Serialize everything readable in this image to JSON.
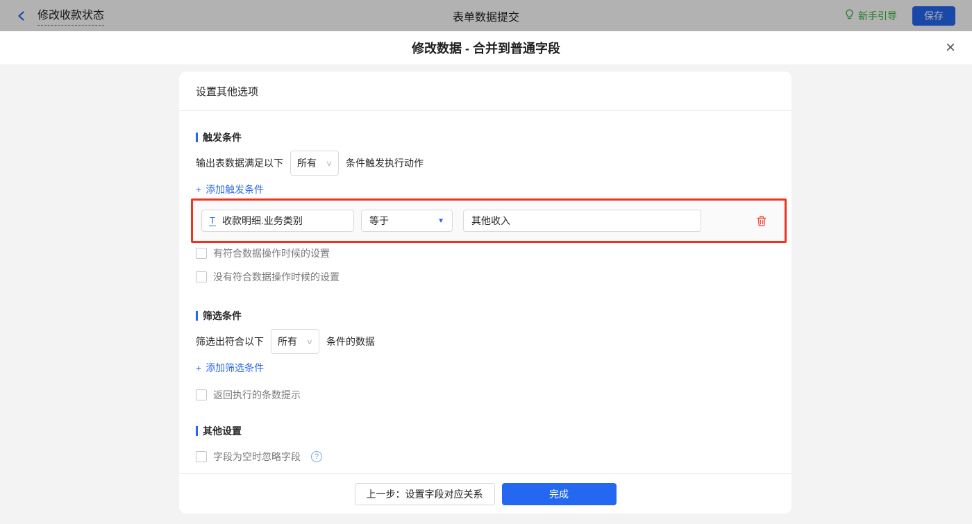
{
  "topbar": {
    "back_label": "修改收款状态",
    "center_title": "表单数据提交",
    "guide_label": "新手引导",
    "save_label": "保存"
  },
  "dialog": {
    "title": "修改数据 - 合并到普通字段",
    "card_header": "设置其他选项"
  },
  "trigger_section": {
    "title": "触发条件",
    "line_prefix": "输出表数据满足以下",
    "select_value": "所有",
    "line_suffix": "条件触发执行动作",
    "add_link_label": "添加触发条件",
    "condition": {
      "field_type_glyph": "T",
      "field_value": "收款明细.业务类别",
      "operator_value": "等于",
      "compare_value": "其他收入"
    },
    "checkbox_match": "有符合数据操作时候的设置",
    "checkbox_no_match": "没有符合数据操作时候的设置"
  },
  "filter_section": {
    "title": "筛选条件",
    "line_prefix": "筛选出符合以下",
    "select_value": "所有",
    "line_suffix": "条件的数据",
    "add_link_label": "添加筛选条件",
    "checkbox_return_count": "返回执行的条数提示"
  },
  "other_section": {
    "title": "其他设置",
    "checkbox_ignore_empty": "字段为空时忽略字段"
  },
  "footer": {
    "prev_label": "上一步：设置字段对应关系",
    "done_label": "完成"
  },
  "icons": {
    "plus": "+",
    "select_chevron": "∨",
    "caret_down": "▼",
    "close": "×",
    "question": "?"
  },
  "colors": {
    "accent_blue": "#2468f2",
    "link_blue": "#2e6be5",
    "highlight_red": "#f0331f",
    "guide_green": "#2faf2f",
    "trash_red": "#f04a3a"
  }
}
